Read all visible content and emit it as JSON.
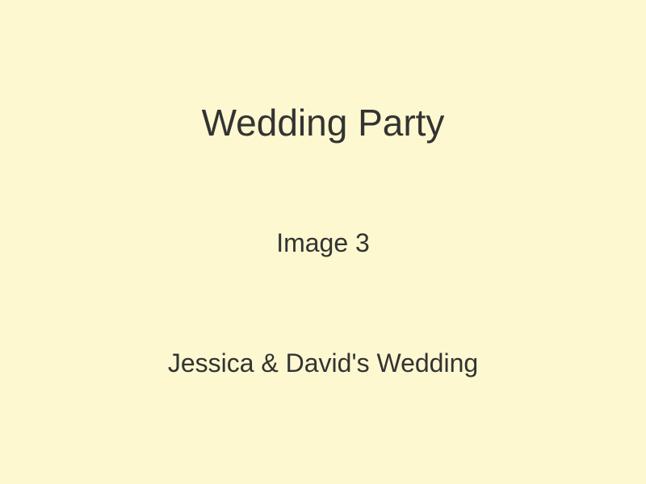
{
  "title": "Wedding Party",
  "image_label": "Image 3",
  "caption": "Jessica & David's Wedding",
  "colors": {
    "background": "#fdf8d0",
    "text": "#333333"
  }
}
